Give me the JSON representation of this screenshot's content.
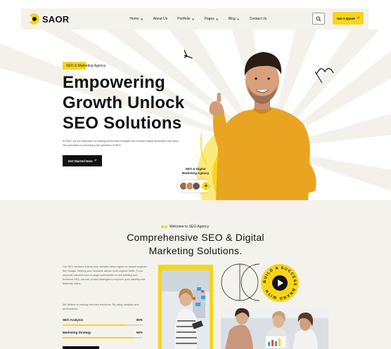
{
  "brand": {
    "name": "SAOR"
  },
  "nav": {
    "items": [
      {
        "label": "Home",
        "has_dropdown": true
      },
      {
        "label": "About Us",
        "has_dropdown": false
      },
      {
        "label": "Portfolio",
        "has_dropdown": true
      },
      {
        "label": "Pages",
        "has_dropdown": true
      },
      {
        "label": "Blog",
        "has_dropdown": true
      },
      {
        "label": "Contact Us",
        "has_dropdown": false
      }
    ],
    "search_icon": "search-icon",
    "cta_label": "Get A Quote",
    "cta_arrow": "↗"
  },
  "hero": {
    "badge": "SEO & Marketing Agency",
    "title_lines": [
      "Empowering",
      "Growth Unlock",
      "SEO Solutions"
    ],
    "description": "At Saor, we are dedicated to helping businesses navigate the complex digital landscape with ease. We specialize in providing a full spectrum of SEO",
    "button_label": "Get Started Now",
    "button_arrow": "↗",
    "label_lines": [
      "SEO & Digital",
      "Marketing Agency"
    ],
    "plus": "+"
  },
  "services": {
    "badge": "Welcome to SEO Agency",
    "title_lines": [
      "Comprehensive SEO & Digital",
      "Marketing Solutions."
    ],
    "description": "Our SEO services ensure your website ranks higher on search engines like Google, helping your business attract more organic traffic. From keyword research and on-page optimization to link building and technical SEO, we use proven strategies to improve your visibility and authority online.",
    "description2": "We believe in making informed decisions. By using analytics and performance",
    "skills": [
      {
        "label": "SEO Analysis",
        "value_label": "80%",
        "value": 0.8
      },
      {
        "label": "Marketing Strategy",
        "value_label": "90%",
        "value": 0.9
      }
    ],
    "ring_text": "BUILD A SUCCESS BRAND WITH"
  },
  "colors": {
    "accent": "#f7d51a",
    "dark": "#111111",
    "section_bg": "#f4f2ec",
    "sweater": "#e9a521"
  }
}
